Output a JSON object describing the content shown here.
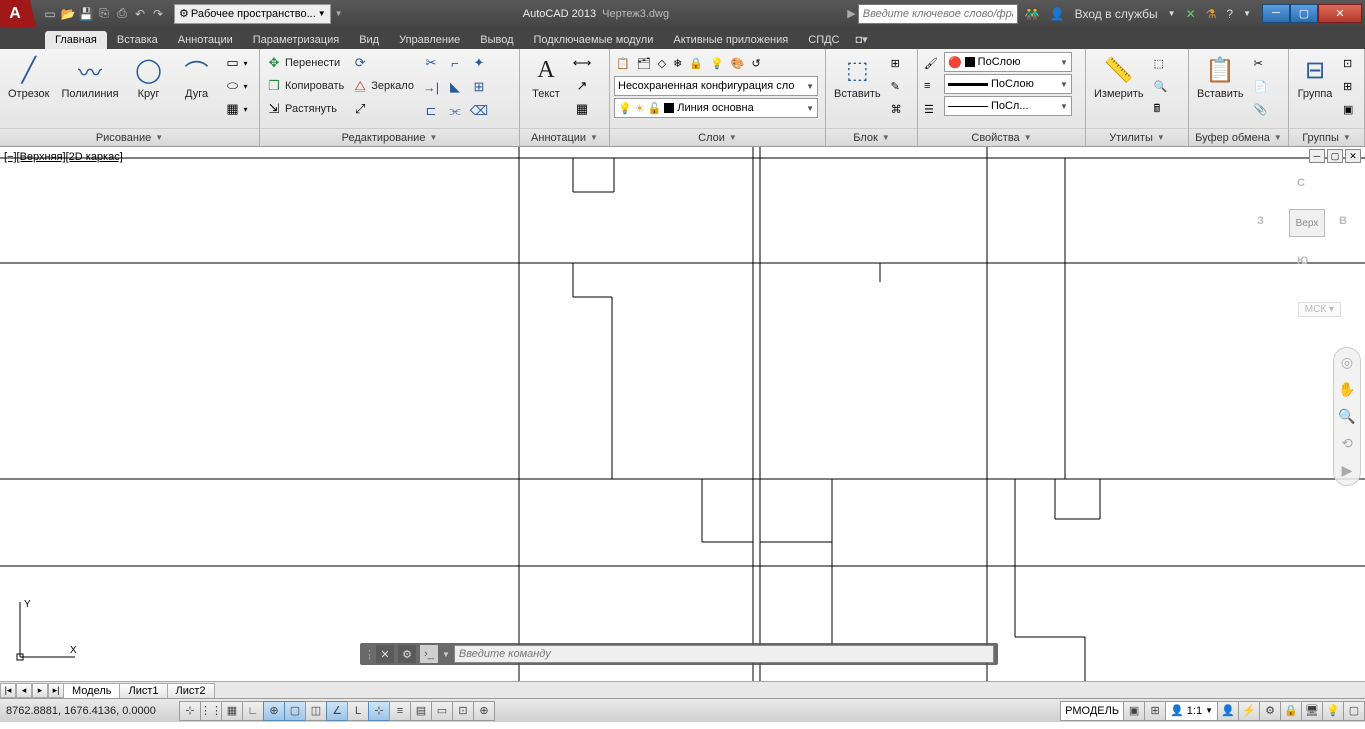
{
  "titlebar": {
    "workspace": "Рабочее пространство...",
    "app": "AutoCAD 2013",
    "file": "Чертеж3.dwg",
    "search_placeholder": "Введите ключевое слово/фразу",
    "signin": "Вход в службы"
  },
  "tabs": [
    "Главная",
    "Вставка",
    "Аннотации",
    "Параметризация",
    "Вид",
    "Управление",
    "Вывод",
    "Подключаемые модули",
    "Активные приложения",
    "СПДС"
  ],
  "ribbon": {
    "draw": {
      "title": "Рисование",
      "line": "Отрезок",
      "polyline": "Полилиния",
      "circle": "Круг",
      "arc": "Дуга"
    },
    "edit": {
      "title": "Редактирование",
      "move": "Перенести",
      "copy": "Копировать",
      "stretch": "Растянуть",
      "rotate": "Повернуть",
      "mirror": "Зеркало",
      "scale": "Масштаб"
    },
    "annot": {
      "title": "Аннотации",
      "text": "Текст"
    },
    "layers": {
      "title": "Слои",
      "unsaved": "Несохраненная конфигурация сло",
      "current": "Линия основна"
    },
    "block": {
      "title": "Блок",
      "insert": "Вставить"
    },
    "props": {
      "title": "Свойства",
      "color": "ПоСлою",
      "lweight": "ПоСлою",
      "ltype": "ПоСл..."
    },
    "utils": {
      "title": "Утилиты",
      "measure": "Измерить"
    },
    "clip": {
      "title": "Буфер обмена",
      "paste": "Вставить"
    },
    "groups": {
      "title": "Группы",
      "group": "Группа"
    }
  },
  "view": {
    "label": "[−][Верхняя][2D каркас]",
    "cube_top": "Верх",
    "dir_n": "С",
    "dir_s": "Ю",
    "dir_e": "В",
    "dir_w": "З",
    "wcs": "МСК"
  },
  "cmd": {
    "placeholder": "Введите команду"
  },
  "layouts": {
    "model": "Модель",
    "sheet1": "Лист1",
    "sheet2": "Лист2"
  },
  "status": {
    "coords": "8762.8881, 1676.4136, 0.0000",
    "rmodel": "РМОДЕЛЬ",
    "scale": "1:1"
  }
}
